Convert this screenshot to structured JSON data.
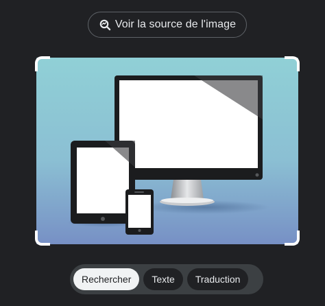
{
  "source_button": {
    "label": "Voir la source de l'image",
    "icon": "lens-search-icon"
  },
  "image": {
    "description_icon": "devices-illustration"
  },
  "modes": {
    "items": [
      {
        "label": "Rechercher",
        "active": true
      },
      {
        "label": "Texte",
        "active": false
      },
      {
        "label": "Traduction",
        "active": false
      }
    ]
  },
  "colors": {
    "background": "#202124",
    "pill_border": "#5f6368",
    "active_chip": "#f1f3f4",
    "image_bg_top": "#8ccfd6",
    "image_bg_bottom": "#7891c4"
  }
}
